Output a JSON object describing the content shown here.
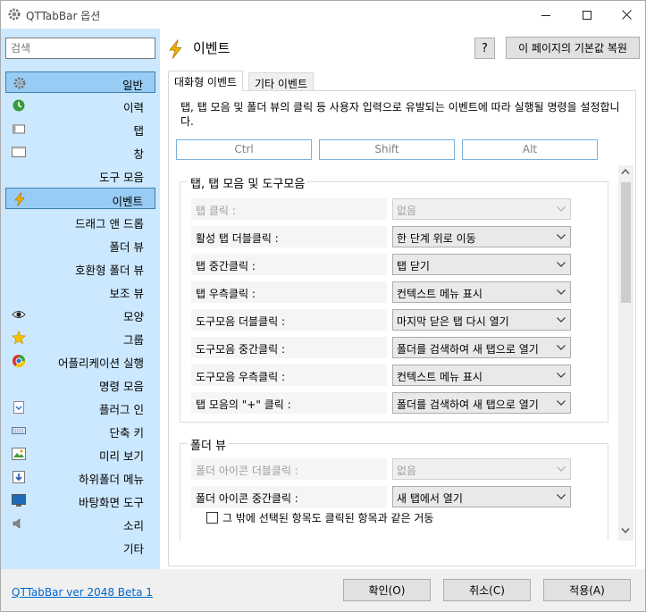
{
  "window": {
    "title": "QTTabBar 옵션"
  },
  "sidebar": {
    "search_placeholder": "검색",
    "items": [
      {
        "label": "일반",
        "icon": "gear-icon"
      },
      {
        "label": "이력",
        "icon": "history-icon"
      },
      {
        "label": "탭",
        "icon": "tab-icon"
      },
      {
        "label": "창",
        "icon": "window-icon"
      },
      {
        "label": "도구 모음",
        "icon": ""
      },
      {
        "label": "이벤트",
        "icon": "lightning-icon"
      },
      {
        "label": "드래그 앤 드롭",
        "icon": ""
      },
      {
        "label": "폴더 뷰",
        "icon": ""
      },
      {
        "label": "호환형 폴더 뷰",
        "icon": ""
      },
      {
        "label": "보조 뷰",
        "icon": ""
      },
      {
        "label": "모양",
        "icon": "eye-icon"
      },
      {
        "label": "그룹",
        "icon": "star-icon"
      },
      {
        "label": "어플리케이션 실행",
        "icon": "app-launch-icon"
      },
      {
        "label": "명령 모음",
        "icon": ""
      },
      {
        "label": "플러그 인",
        "icon": "plugin-icon"
      },
      {
        "label": "단축 키",
        "icon": "keyboard-icon"
      },
      {
        "label": "미리 보기",
        "icon": "preview-icon"
      },
      {
        "label": "하위폴더 메뉴",
        "icon": "subfolder-icon"
      },
      {
        "label": "바탕화면 도구",
        "icon": "desktop-icon"
      },
      {
        "label": "소리",
        "icon": "speaker-icon"
      },
      {
        "label": "기타",
        "icon": ""
      }
    ],
    "selected_index": 5
  },
  "main": {
    "title": "이벤트",
    "help_label": "?",
    "reset_label": "이 페이지의 기본값 복원",
    "tabs": [
      {
        "label": "대화형 이벤트"
      },
      {
        "label": "기타 이벤트"
      }
    ],
    "description": "탭, 탭 모음 및 폴더 뷰의 클릭 등 사용자 입력으로 유발되는 이벤트에 따라 실행될 명령을 설정합니다.",
    "modifiers": {
      "ctrl": "Ctrl",
      "shift": "Shift",
      "alt": "Alt"
    },
    "group1": {
      "title": "탭, 탭 모음 및 도구모음",
      "rows": [
        {
          "label": "탭 클릭 :",
          "value": "없음",
          "disabled": true
        },
        {
          "label": "활성 탭 더블클릭 :",
          "value": "한 단계 위로 이동"
        },
        {
          "label": "탭 중간클릭 :",
          "value": "탭 닫기"
        },
        {
          "label": "탭 우측클릭 :",
          "value": "컨텍스트 메뉴 표시"
        },
        {
          "label": "도구모음 더블클릭 :",
          "value": "마지막 닫은 탭 다시 열기"
        },
        {
          "label": "도구모음 중간클릭 :",
          "value": "폴더를 검색하여 새 탭으로 열기"
        },
        {
          "label": "도구모음 우측클릭 :",
          "value": "컨텍스트 메뉴 표시"
        },
        {
          "label": "탭 모음의 \"+\" 클릭 :",
          "value": "폴더를 검색하여 새 탭으로 열기"
        }
      ]
    },
    "group2": {
      "title": "폴더 뷰",
      "rows": [
        {
          "label": "폴더 아이콘 더블클릭 :",
          "value": "없음",
          "disabled": true
        },
        {
          "label": "폴더 아이콘 중간클릭 :",
          "value": "새 탭에서 열기"
        }
      ],
      "checkbox_label": "그 밖에 선택된 항목도 클릭된 항목과 같은 거동"
    }
  },
  "footer": {
    "version": "QTTabBar ver 2048 Beta 1",
    "ok": "확인(O)",
    "cancel": "취소(C)",
    "apply": "적용(A)"
  },
  "colors": {
    "sidebar_bg": "#cce8ff",
    "selected_bg": "#99ccf4",
    "selected_border": "#3c7fb1",
    "link": "#0066cc"
  }
}
